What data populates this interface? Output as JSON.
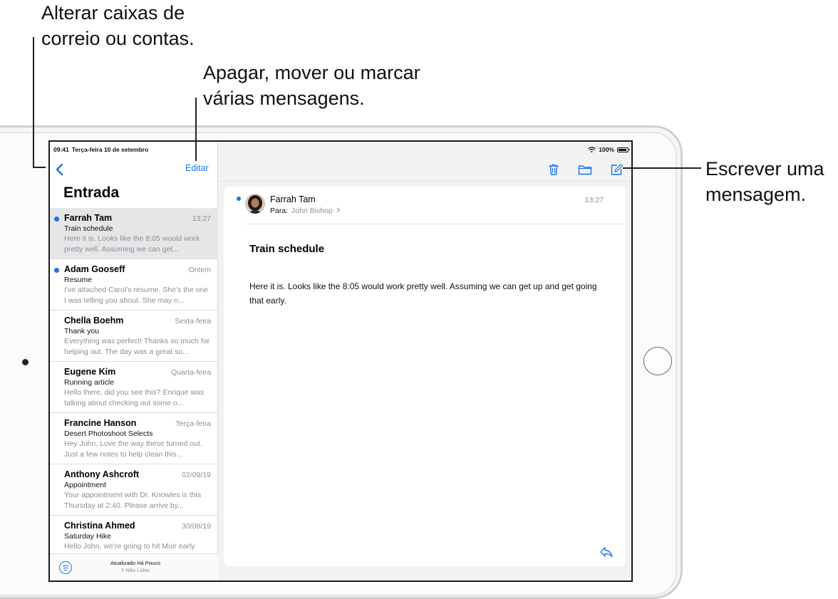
{
  "callouts": {
    "mailboxes": "Alterar caixas de\ncorreio ou contas.",
    "edit": "Apagar, mover ou marcar\nvárias mensagens.",
    "compose": "Escrever uma\nmensagem."
  },
  "status_bar": {
    "time": "09:41",
    "date": "Terça-feira 10 de setembro",
    "battery": "100%"
  },
  "sidebar": {
    "edit_label": "Editar",
    "title": "Entrada",
    "mails": [
      {
        "sender": "Farrah Tam",
        "date": "13:27",
        "subject": "Train schedule",
        "preview": "Here it is. Looks like the 8:05 would work pretty well. Assuming we can get...",
        "unread": true,
        "selected": true
      },
      {
        "sender": "Adam Gooseff",
        "date": "Ontem",
        "subject": "Resume",
        "preview": "I've attached Carol's resume. She's the one I was telling you about. She may n...",
        "unread": true,
        "selected": false
      },
      {
        "sender": "Chella Boehm",
        "date": "Sexta-feira",
        "subject": "Thank you",
        "preview": "Everything was perfect! Thanks so much for helping out. The day was a great su...",
        "unread": false,
        "selected": false
      },
      {
        "sender": "Eugene Kim",
        "date": "Quarta-feira",
        "subject": "Running article",
        "preview": "Hello there, did you see this? Enrique was talking about checking out some o...",
        "unread": false,
        "selected": false
      },
      {
        "sender": "Francine Hanson",
        "date": "Terça-feira",
        "subject": "Desert Photoshoot Selects",
        "preview": "Hey John, Love the way these turned out. Just a few notes to help clean this...",
        "unread": false,
        "selected": false
      },
      {
        "sender": "Anthony Ashcroft",
        "date": "02/09/19",
        "subject": "Appointment",
        "preview": "Your appointment with Dr. Knowles is this Thursday at 2:40. Please arrive by...",
        "unread": false,
        "selected": false
      },
      {
        "sender": "Christina Ahmed",
        "date": "30/08/19",
        "subject": "Saturday Hike",
        "preview": "Hello John, we're going to hit Muir early",
        "unread": false,
        "selected": false
      }
    ],
    "footer": {
      "line1": "Atualizado Há Pouco",
      "line2": "5 Não Lidas"
    }
  },
  "message": {
    "from": "Farrah Tam",
    "to_label": "Para:",
    "to_name": "John Bishop",
    "time": "13:27",
    "subject": "Train schedule",
    "body": "Here it is. Looks like the 8:05 would work pretty well. Assuming we can get up and get going that early."
  },
  "icons": {
    "back": "chevron-left-icon",
    "trash": "trash-icon",
    "folder": "folder-icon",
    "compose": "compose-icon",
    "reply": "reply-icon",
    "filter": "filter-icon",
    "wifi": "wifi-icon",
    "battery": "battery-icon"
  },
  "colors": {
    "accent": "#1a73e8",
    "unread_dot": "#1a73e8",
    "secondary_text": "#8e8e93",
    "selected_row": "#e6e6e9"
  }
}
